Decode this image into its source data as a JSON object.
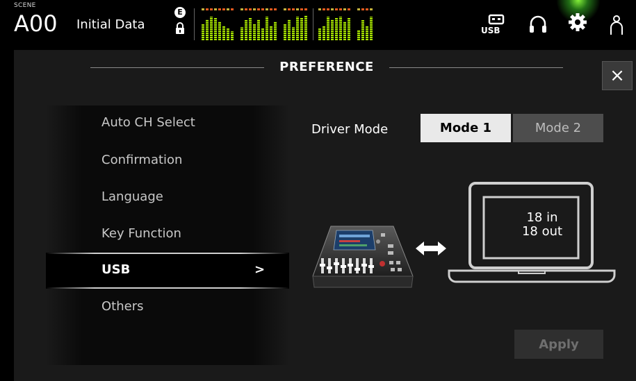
{
  "header": {
    "scene_label": "SCENE",
    "scene_number": "A00",
    "scene_name": "Initial Data",
    "edit_badge": "E",
    "usb_label": "USB"
  },
  "meters": {
    "group1": [
      0.6,
      0.8,
      0.9,
      0.85,
      0.7,
      0.55,
      0.45,
      0.35
    ],
    "group2": [
      0.5,
      0.75,
      0.85,
      0.6,
      0.8,
      0.45,
      0.9,
      0.55,
      0.7
    ],
    "group3": [
      0.6,
      0.8,
      0.5,
      0.9,
      0.85,
      0.95
    ],
    "group4": [
      0.45,
      0.55,
      0.9,
      0.8,
      0.85,
      0.9,
      0.7,
      0.85
    ],
    "group5": [
      0.4,
      0.75,
      0.55,
      0.9
    ],
    "colors": {
      "green": "#a9e400",
      "peak": "#e45a1e",
      "amber": "#c6b43c"
    }
  },
  "panel": {
    "title": "PREFERENCE",
    "close_label": "×"
  },
  "menu": {
    "items": [
      {
        "label": "Auto CH Select"
      },
      {
        "label": "Confirmation"
      },
      {
        "label": "Language"
      },
      {
        "label": "Key Function"
      },
      {
        "label": "USB",
        "selected": true
      },
      {
        "label": "Others"
      }
    ],
    "selected_arrow": ">"
  },
  "usb": {
    "driver_mode_label": "Driver Mode",
    "mode1_label": "Mode 1",
    "mode2_label": "Mode 2",
    "selected_mode": "Mode 1",
    "channels_in": "18 in",
    "channels_out": "18 out",
    "apply_label": "Apply"
  }
}
